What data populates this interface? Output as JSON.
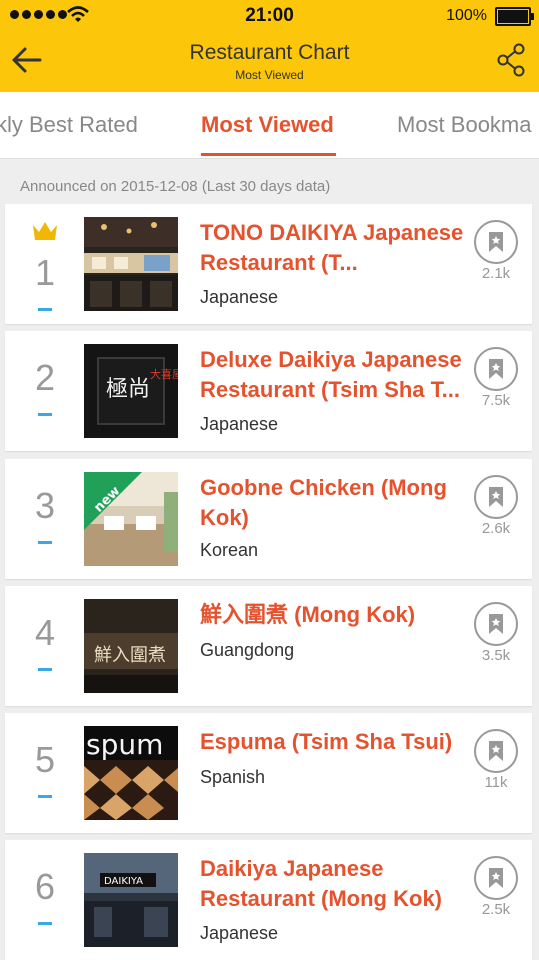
{
  "status_bar": {
    "time": "21:00",
    "battery": "100%"
  },
  "header": {
    "title": "Restaurant Chart",
    "subtitle": "Most Viewed",
    "back_icon": "back-arrow-icon",
    "share_icon": "share-icon"
  },
  "tabs": [
    {
      "label": "kly Best Rated",
      "active": false
    },
    {
      "label": "Most Viewed",
      "active": true
    },
    {
      "label": "Most Bookma",
      "active": false
    }
  ],
  "announcement": "Announced on 2015-12-08 (Last 30 days data)",
  "colors": {
    "accent": "#e5532e",
    "header_bg": "#fcc60b",
    "rank_change": "#3aa8e6",
    "new_badge": "#21a05a"
  },
  "restaurants": [
    {
      "rank": "1",
      "name": "TONO DAIKIYA Japanese Restaurant (T...",
      "cuisine": "Japanese",
      "bookmarks": "2.1k",
      "crown": true
    },
    {
      "rank": "2",
      "name": "Deluxe Daikiya Japanese Restaurant (Tsim Sha T...",
      "cuisine": "Japanese",
      "bookmarks": "7.5k"
    },
    {
      "rank": "3",
      "name": "Goobne Chicken (Mong Kok)",
      "cuisine": "Korean",
      "bookmarks": "2.6k",
      "badge": "new"
    },
    {
      "rank": "4",
      "name": "鮮入圍煮 (Mong Kok)",
      "cuisine": "Guangdong",
      "bookmarks": "3.5k"
    },
    {
      "rank": "5",
      "name": "Espuma (Tsim Sha Tsui)",
      "cuisine": "Spanish",
      "bookmarks": "11k"
    },
    {
      "rank": "6",
      "name": "Daikiya Japanese Restaurant (Mong Kok)",
      "cuisine": "Japanese",
      "bookmarks": "2.5k"
    }
  ],
  "photo_text": {
    "r2_sign": "極尚",
    "r2_sign_red": "大喜屋",
    "r4_sign": "鮮入圍煮",
    "r5_sign": "spum",
    "r6_sign": "DAIKIYA"
  }
}
